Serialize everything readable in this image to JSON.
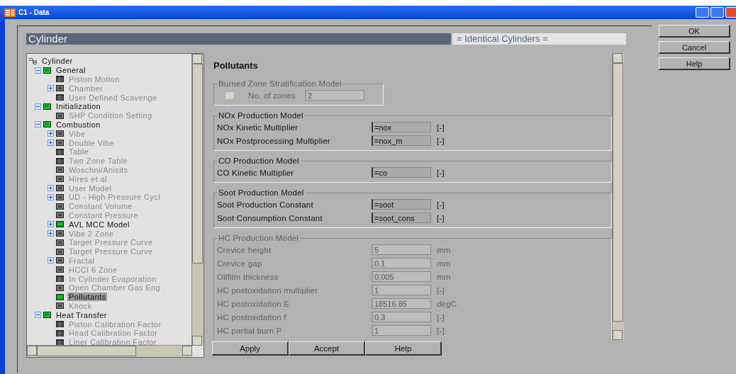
{
  "window": {
    "title": "C1 - Data"
  },
  "header": {
    "title": "Cylinder",
    "subtitle": "= Identical Cylinders ="
  },
  "tree": {
    "label": "Cylinder",
    "children": [
      {
        "label": "General",
        "kind": "group",
        "active": true,
        "selected": false,
        "expanded": true,
        "children": [
          {
            "label": "Piston Motion",
            "kind": "table",
            "active": false,
            "selected": false
          },
          {
            "label": "Chamber",
            "kind": "form",
            "active": false,
            "selected": false,
            "expanded": false
          },
          {
            "label": "User Defined Scavenge",
            "kind": "table",
            "active": false,
            "selected": false
          }
        ]
      },
      {
        "label": "Initialization",
        "kind": "group",
        "active": true,
        "selected": false,
        "expanded": true,
        "children": [
          {
            "label": "SHP Condition Setting",
            "kind": "form",
            "active": false,
            "selected": false
          }
        ]
      },
      {
        "label": "Combustion",
        "kind": "group",
        "active": true,
        "selected": false,
        "expanded": true,
        "children": [
          {
            "label": "Vibe",
            "kind": "form",
            "active": false,
            "selected": false,
            "expanded": false
          },
          {
            "label": "Double Vibe",
            "kind": "form",
            "active": false,
            "selected": false,
            "expanded": false
          },
          {
            "label": "Table",
            "kind": "table",
            "active": false,
            "selected": false
          },
          {
            "label": "Two Zone Table",
            "kind": "table",
            "active": false,
            "selected": false
          },
          {
            "label": "Woschni/Anisits",
            "kind": "form",
            "active": false,
            "selected": false
          },
          {
            "label": "Hires et al",
            "kind": "form",
            "active": false,
            "selected": false
          },
          {
            "label": "User Model",
            "kind": "form",
            "active": false,
            "selected": false,
            "expanded": false
          },
          {
            "label": "UD - High Pressure Cycl",
            "kind": "form",
            "active": false,
            "selected": false,
            "expanded": false
          },
          {
            "label": "Constant Volume",
            "kind": "form",
            "active": false,
            "selected": false
          },
          {
            "label": "Constant Pressure",
            "kind": "form",
            "active": false,
            "selected": false
          },
          {
            "label": "AVL MCC Model",
            "kind": "form",
            "active": true,
            "selected": false,
            "expanded": false
          },
          {
            "label": "Vibe 2 Zone",
            "kind": "form",
            "active": false,
            "selected": false,
            "expanded": false
          },
          {
            "label": "Target Pressure Curve",
            "kind": "form",
            "active": false,
            "selected": false
          },
          {
            "label": "Target Pressure Curve",
            "kind": "form",
            "active": false,
            "selected": false
          },
          {
            "label": "Fractal",
            "kind": "form",
            "active": false,
            "selected": false,
            "expanded": false
          },
          {
            "label": "HCCI 6 Zone",
            "kind": "form",
            "active": false,
            "selected": false
          },
          {
            "label": "In Cylinder Evaporation",
            "kind": "table",
            "active": false,
            "selected": false
          },
          {
            "label": "Open Chamber Gas Eng",
            "kind": "form",
            "active": false,
            "selected": false
          },
          {
            "label": "Pollutants",
            "kind": "form",
            "active": true,
            "selected": true
          },
          {
            "label": "Knock",
            "kind": "form",
            "active": false,
            "selected": false
          }
        ]
      },
      {
        "label": "Heat Transfer",
        "kind": "group",
        "active": true,
        "selected": false,
        "expanded": true,
        "children": [
          {
            "label": "Piston Calibration Factor",
            "kind": "table",
            "active": false,
            "selected": false
          },
          {
            "label": "Head Calibration Factor",
            "kind": "table",
            "active": false,
            "selected": false
          },
          {
            "label": "Liner Calibration Factor",
            "kind": "table",
            "active": false,
            "selected": false
          }
        ]
      }
    ]
  },
  "form": {
    "title": "Pollutants",
    "groups": [
      {
        "title": "Burned Zone Stratification Model",
        "disabled": true,
        "rows": [
          {
            "kind": "checkbox",
            "checked": false,
            "label": "No. of zones",
            "value": "2"
          }
        ]
      },
      {
        "title": "NOx Production Model",
        "disabled": false,
        "rows": [
          {
            "kind": "field",
            "label": "NOx Kinetic Multiplier",
            "value": "=nox",
            "unit": "[-]"
          },
          {
            "kind": "field",
            "label": "NOx Postprocessing Multiplier",
            "value": "=nox_m",
            "unit": "[-]"
          }
        ]
      },
      {
        "title": "CO Production Model",
        "disabled": false,
        "rows": [
          {
            "kind": "field",
            "label": "CO Kinetic Multiplier",
            "value": "=co",
            "unit": "[-]"
          }
        ]
      },
      {
        "title": "Soot Production Model",
        "disabled": false,
        "rows": [
          {
            "kind": "field",
            "label": "Soot Production Constant",
            "value": "=soot",
            "unit": "[-]"
          },
          {
            "kind": "field",
            "label": "Soot Consumption Constant",
            "value": "=soot_cons",
            "unit": "[-]"
          }
        ]
      },
      {
        "title": "HC Production Model",
        "disabled": true,
        "rows": [
          {
            "kind": "field",
            "label": "Crevice height",
            "value": "5",
            "unit": "mm"
          },
          {
            "kind": "field",
            "label": "Crevice gap",
            "value": "0.1",
            "unit": "mm"
          },
          {
            "kind": "field",
            "label": "Oilfilm thickness",
            "value": "0.005",
            "unit": "mm"
          },
          {
            "kind": "field",
            "label": "HC postoxidation multiplier",
            "value": "1",
            "unit": "[-]"
          },
          {
            "kind": "field",
            "label": "HC postoxidation E",
            "value": "18516.85",
            "unit": "degC"
          },
          {
            "kind": "field",
            "label": "HC postoxidation f",
            "value": "0.3",
            "unit": "[-]"
          },
          {
            "kind": "field",
            "label": "HC partial burn P",
            "value": "1",
            "unit": "[-]"
          }
        ]
      }
    ]
  },
  "form_buttons": [
    "Apply",
    "Accept",
    "Help"
  ],
  "dialog_buttons": [
    "OK",
    "Cancel",
    "Help"
  ]
}
